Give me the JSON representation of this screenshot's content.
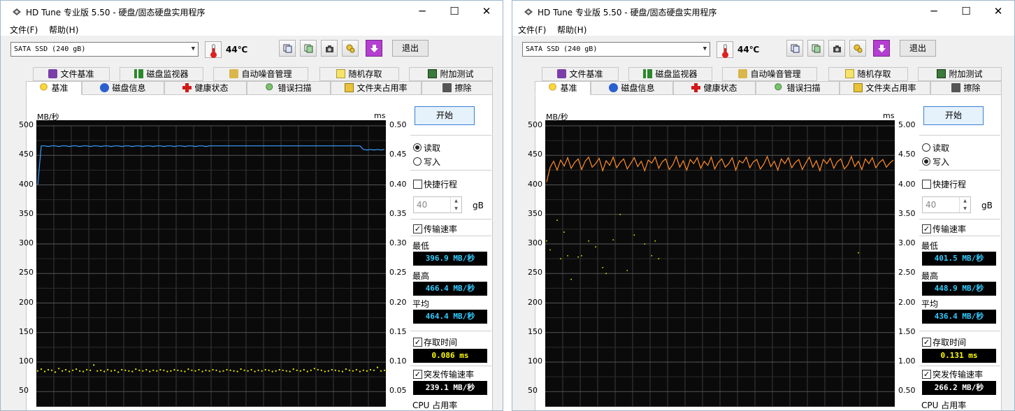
{
  "app": {
    "title": "HD Tune 专业版 5.50 - 硬盘/固态硬盘实用程序",
    "controls": {
      "minimize": "─",
      "maximize": "☐",
      "close": "✕"
    },
    "menu": [
      "文件(F)",
      "帮助(H)"
    ],
    "drive": "SATA SSD (240 gB)",
    "exit_label": "退出",
    "tabs_top": [
      "文件基准",
      "磁盘监视器",
      "自动噪音管理",
      "随机存取",
      "附加测试"
    ],
    "tabs_bottom": [
      "基准",
      "磁盘信息",
      "健康状态",
      "错误扫描",
      "文件夹占用率",
      "擦除"
    ],
    "start_label": "开始",
    "read_label": "读取",
    "write_label": "写入",
    "short_stroke_label": "快捷行程",
    "short_stroke_value": "40",
    "gb_unit": "gB",
    "transfer_rate_label": "传输速率",
    "min_label": "最低",
    "max_label": "最高",
    "avg_label": "平均",
    "access_time_label": "存取时间",
    "burst_label": "突发传输速率",
    "cpu_label": "CPU 占用率",
    "unit_left": "MB/秒",
    "unit_right": "ms",
    "colors": {
      "stat_blue": "#33ccff",
      "stat_yellow": "#ffff00",
      "read_line": "#3aa0ff",
      "write_line": "#ff8c28",
      "access_dots": "#f0f000"
    }
  },
  "windows": [
    {
      "id": "left",
      "mode": "read",
      "temperature": "44℃",
      "stats": {
        "min": "396.9 MB/秒",
        "max": "466.4 MB/秒",
        "avg": "464.4 MB/秒",
        "access": "0.086 ms",
        "burst": "239.1 MB/秒"
      }
    },
    {
      "id": "right",
      "mode": "write",
      "temperature": "44℃",
      "stats": {
        "min": "401.5 MB/秒",
        "max": "448.9 MB/秒",
        "avg": "436.4 MB/秒",
        "access": "0.131 ms",
        "burst": "266.2 MB/秒"
      }
    }
  ],
  "chart_data": [
    {
      "type": "line",
      "title": "",
      "xlabel": "",
      "ylabel": "MB/秒",
      "y2label": "ms",
      "ylim": [
        0,
        500
      ],
      "y2lim": [
        0,
        0.5
      ],
      "yticks": [
        500,
        450,
        400,
        350,
        300,
        250,
        200,
        150,
        100,
        50
      ],
      "y2ticks": [
        "0.50",
        "0.45",
        "0.40",
        "0.35",
        "0.30",
        "0.25",
        "0.20",
        "0.15",
        "0.10",
        "0.05"
      ],
      "grid": true,
      "series": [
        {
          "kind": "transfer",
          "values": [
            400,
            466,
            466,
            465,
            466,
            466,
            465,
            466,
            466,
            465,
            466,
            466,
            465,
            466,
            466,
            465,
            466,
            466,
            465,
            466,
            466,
            465,
            466,
            466,
            465,
            466,
            466,
            465,
            466,
            466,
            465,
            466,
            466,
            465,
            466,
            466,
            465,
            466,
            466,
            465,
            466,
            466,
            465,
            466,
            466,
            465,
            466,
            466,
            465,
            466,
            466,
            466,
            466,
            466,
            466,
            466,
            466,
            466,
            466,
            466,
            466,
            466,
            466,
            466,
            466,
            466,
            466,
            466,
            466,
            466,
            466,
            466,
            466,
            466,
            466,
            466,
            466,
            466,
            466,
            466,
            466,
            466,
            466,
            466,
            466,
            466,
            466,
            466,
            466,
            466,
            466,
            466,
            466,
            460,
            459,
            460,
            459,
            460,
            459,
            460
          ]
        },
        {
          "kind": "access_ms",
          "values": [
            0.085,
            0.088,
            0.084,
            0.087,
            0.086,
            0.083,
            0.089,
            0.085,
            0.087,
            0.084,
            0.086,
            0.088,
            0.085,
            0.084,
            0.087,
            0.086,
            0.095,
            0.085,
            0.086,
            0.084,
            0.087,
            0.085,
            0.086,
            0.083,
            0.087,
            0.086,
            0.085,
            0.084,
            0.088,
            0.086,
            0.085,
            0.087,
            0.084,
            0.086,
            0.085,
            0.087,
            0.086,
            0.084,
            0.085,
            0.087,
            0.086,
            0.085,
            0.084,
            0.088,
            0.086,
            0.085,
            0.087,
            0.084,
            0.086,
            0.085,
            0.087,
            0.086,
            0.084,
            0.085,
            0.087,
            0.086,
            0.085,
            0.084,
            0.088,
            0.086,
            0.085,
            0.087,
            0.084,
            0.086,
            0.085,
            0.087,
            0.086,
            0.084,
            0.085,
            0.087,
            0.086,
            0.085,
            0.084,
            0.088,
            0.086,
            0.085,
            0.087,
            0.084,
            0.086,
            0.089,
            0.087,
            0.086,
            0.084,
            0.085,
            0.087,
            0.086,
            0.085,
            0.084,
            0.088,
            0.086,
            0.085,
            0.087,
            0.084,
            0.086,
            0.085,
            0.087,
            0.086,
            0.091,
            0.085,
            0.086
          ]
        }
      ]
    },
    {
      "type": "line",
      "title": "",
      "xlabel": "",
      "ylabel": "MB/秒",
      "y2label": "ms",
      "ylim": [
        0,
        500
      ],
      "y2lim": [
        0,
        5.0
      ],
      "yticks": [
        500,
        450,
        400,
        350,
        300,
        250,
        200,
        150,
        100,
        50
      ],
      "y2ticks": [
        "5.00",
        "4.50",
        "4.00",
        "3.50",
        "3.00",
        "2.50",
        "2.00",
        "1.50",
        "1.00",
        "0.50"
      ],
      "grid": true,
      "series": [
        {
          "kind": "transfer",
          "values": [
            405,
            430,
            440,
            425,
            442,
            432,
            446,
            428,
            438,
            444,
            426,
            440,
            447,
            430,
            436,
            445,
            424,
            441,
            433,
            447,
            429,
            438,
            444,
            427,
            436,
            446,
            431,
            440,
            424,
            442,
            437,
            447,
            428,
            439,
            444,
            426,
            434,
            448,
            430,
            441,
            425,
            443,
            436,
            446,
            428,
            440,
            433,
            447,
            427,
            438,
            444,
            430,
            436,
            446,
            425,
            441,
            437,
            447,
            429,
            439,
            443,
            427,
            435,
            448,
            431,
            440,
            425,
            444,
            436,
            446,
            429,
            438,
            443,
            426,
            437,
            447,
            430,
            441,
            424,
            443,
            436,
            445,
            428,
            439,
            444,
            427,
            434,
            448,
            431,
            440,
            426,
            444,
            436,
            446,
            429,
            438,
            443,
            430,
            437,
            442
          ]
        },
        {
          "kind": "access_ms",
          "values": [
            3.05,
            2.9,
            0.2,
            3.4,
            2.75,
            3.2,
            2.8,
            2.4,
            0.15,
            2.78,
            2.8,
            0.12,
            3.05,
            0.18,
            2.95,
            0.1,
            2.6,
            2.5,
            0.14,
            3.07,
            0.16,
            3.5,
            0.12,
            2.55,
            0.11,
            3.15,
            0.15,
            0.13,
            3.0,
            0.12,
            2.8,
            3.05,
            2.75,
            0.14,
            0.12,
            0.11,
            0.13,
            0.12,
            0.1,
            0.14,
            0.12,
            0.11,
            0.13,
            0.1,
            0.12,
            0.14,
            0.11,
            0.13,
            0.12,
            0.1,
            0.11,
            0.13,
            0.12,
            0.14,
            0.1,
            0.12,
            0.11,
            0.13,
            0.12,
            0.14,
            0.11,
            0.1,
            0.13,
            0.12,
            0.11,
            0.14,
            0.1,
            0.12,
            0.13,
            0.11,
            0.12,
            0.1,
            0.14,
            0.11,
            0.13,
            0.12,
            0.1,
            0.11,
            0.14,
            0.12,
            0.13,
            0.1,
            0.11,
            0.12,
            0.14,
            0.13,
            0.1,
            0.11,
            0.12,
            2.85,
            0.13,
            0.11,
            0.1,
            0.12,
            0.14,
            0.11,
            0.13,
            0.12,
            0.1,
            0.11
          ]
        }
      ]
    }
  ]
}
